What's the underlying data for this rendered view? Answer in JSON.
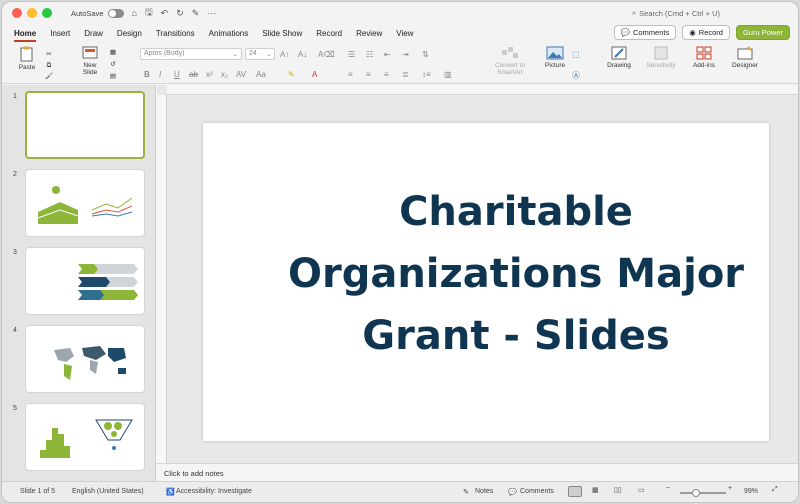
{
  "titlebar": {
    "autosave_label": "AutoSave",
    "search_placeholder": "Search (Cmd + Ctrl + U)"
  },
  "tabs": [
    "Home",
    "Insert",
    "Draw",
    "Design",
    "Transitions",
    "Animations",
    "Slide Show",
    "Record",
    "Review",
    "View"
  ],
  "tab_actions": {
    "comments": "Comments",
    "record": "Record",
    "guru": "Guru Power"
  },
  "ribbon": {
    "paste": "Paste",
    "new_slide_line1": "New",
    "new_slide_line2": "Slide",
    "font_name": "Aptos (Body)",
    "font_size": "24",
    "convert_line1": "Convert to",
    "convert_line2": "SmartArt",
    "picture": "Picture",
    "drawing": "Drawing",
    "sensitivity": "Sensitivity",
    "addins": "Add-ins",
    "designer": "Designer"
  },
  "slides": [
    {
      "number": "1"
    },
    {
      "number": "2"
    },
    {
      "number": "3"
    },
    {
      "number": "4"
    },
    {
      "number": "5"
    }
  ],
  "slide": {
    "title_line1": "Charitable",
    "title_line2": "Organizations Major",
    "title_line3": "Grant - Slides"
  },
  "notes_placeholder": "Click to add notes",
  "status": {
    "slide_count": "Slide 1 of 5",
    "language": "English (United States)",
    "accessibility": "Accessibility: Investigate",
    "notes": "Notes",
    "comments": "Comments",
    "zoom": "99%"
  },
  "colors": {
    "accent": "#c43e1c",
    "title": "#0f3550",
    "green": "#8db638"
  }
}
